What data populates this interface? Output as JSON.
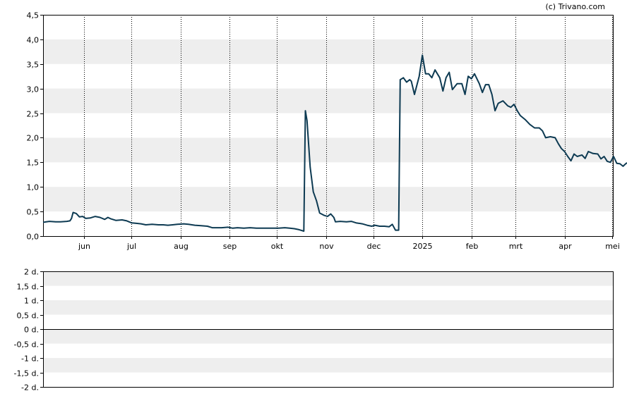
{
  "copyright": "(c) Trivano.com",
  "colors": {
    "line": "#0d3a52",
    "band": "#eeeeee",
    "frame": "#000000",
    "grid": "#000000"
  },
  "chart_data": [
    {
      "type": "line",
      "title": "",
      "xlabel": "",
      "ylabel": "",
      "ylim": [
        0,
        4.5
      ],
      "y_ticks": [
        "0,0",
        "0,5",
        "1,0",
        "1,5",
        "2,0",
        "2,5",
        "3,0",
        "3,5",
        "4,0",
        "4,5"
      ],
      "x_ticks": [
        "jun",
        "jul",
        "aug",
        "sep",
        "okt",
        "nov",
        "dec",
        "2025",
        "feb",
        "mrt",
        "apr",
        "mei"
      ],
      "x_range": [
        "2024-05-06",
        "2025-05-02"
      ],
      "x_tick_dates": [
        "2024-06-01",
        "2024-07-01",
        "2024-08-01",
        "2024-09-01",
        "2024-10-01",
        "2024-11-01",
        "2024-12-01",
        "2025-01-01",
        "2025-02-01",
        "2025-03-01",
        "2025-04-01",
        "2025-05-01"
      ],
      "vertical_grid": "dotted",
      "horizontal_bands": true,
      "series": [
        {
          "points": [
            [
              "2024-05-06",
              0.28
            ],
            [
              "2024-05-08",
              0.29
            ],
            [
              "2024-05-10",
              0.3
            ],
            [
              "2024-05-14",
              0.29
            ],
            [
              "2024-05-17",
              0.29
            ],
            [
              "2024-05-21",
              0.3
            ],
            [
              "2024-05-23",
              0.31
            ],
            [
              "2024-05-24",
              0.36
            ],
            [
              "2024-05-25",
              0.48
            ],
            [
              "2024-05-27",
              0.46
            ],
            [
              "2024-05-29",
              0.39
            ],
            [
              "2024-05-31",
              0.4
            ],
            [
              "2024-06-02",
              0.36
            ],
            [
              "2024-06-05",
              0.37
            ],
            [
              "2024-06-08",
              0.4
            ],
            [
              "2024-06-11",
              0.38
            ],
            [
              "2024-06-14",
              0.34
            ],
            [
              "2024-06-16",
              0.38
            ],
            [
              "2024-06-18",
              0.35
            ],
            [
              "2024-06-21",
              0.32
            ],
            [
              "2024-06-25",
              0.33
            ],
            [
              "2024-06-28",
              0.31
            ],
            [
              "2024-07-01",
              0.27
            ],
            [
              "2024-07-04",
              0.26
            ],
            [
              "2024-07-07",
              0.25
            ],
            [
              "2024-07-10",
              0.23
            ],
            [
              "2024-07-14",
              0.24
            ],
            [
              "2024-07-18",
              0.23
            ],
            [
              "2024-07-21",
              0.23
            ],
            [
              "2024-07-24",
              0.22
            ],
            [
              "2024-07-27",
              0.23
            ],
            [
              "2024-07-30",
              0.24
            ],
            [
              "2024-08-03",
              0.25
            ],
            [
              "2024-08-06",
              0.24
            ],
            [
              "2024-08-10",
              0.22
            ],
            [
              "2024-08-14",
              0.21
            ],
            [
              "2024-08-18",
              0.2
            ],
            [
              "2024-08-21",
              0.17
            ],
            [
              "2024-08-24",
              0.17
            ],
            [
              "2024-08-27",
              0.17
            ],
            [
              "2024-08-31",
              0.18
            ],
            [
              "2024-09-03",
              0.16
            ],
            [
              "2024-09-06",
              0.17
            ],
            [
              "2024-09-10",
              0.16
            ],
            [
              "2024-09-14",
              0.17
            ],
            [
              "2024-09-18",
              0.16
            ],
            [
              "2024-09-21",
              0.16
            ],
            [
              "2024-09-25",
              0.16
            ],
            [
              "2024-09-29",
              0.16
            ],
            [
              "2024-10-02",
              0.16
            ],
            [
              "2024-10-06",
              0.17
            ],
            [
              "2024-10-09",
              0.16
            ],
            [
              "2024-10-12",
              0.15
            ],
            [
              "2024-10-15",
              0.13
            ],
            [
              "2024-10-18",
              0.1
            ],
            [
              "2024-10-19",
              2.55
            ],
            [
              "2024-10-20",
              2.35
            ],
            [
              "2024-10-22",
              1.4
            ],
            [
              "2024-10-24",
              0.9
            ],
            [
              "2024-10-26",
              0.72
            ],
            [
              "2024-10-28",
              0.47
            ],
            [
              "2024-10-31",
              0.42
            ],
            [
              "2024-11-02",
              0.4
            ],
            [
              "2024-11-04",
              0.45
            ],
            [
              "2024-11-06",
              0.38
            ],
            [
              "2024-11-07",
              0.29
            ],
            [
              "2024-11-10",
              0.3
            ],
            [
              "2024-11-14",
              0.29
            ],
            [
              "2024-11-17",
              0.3
            ],
            [
              "2024-11-20",
              0.27
            ],
            [
              "2024-11-24",
              0.25
            ],
            [
              "2024-11-27",
              0.22
            ],
            [
              "2024-11-30",
              0.2
            ],
            [
              "2024-12-02",
              0.22
            ],
            [
              "2024-12-05",
              0.2
            ],
            [
              "2024-12-08",
              0.2
            ],
            [
              "2024-12-11",
              0.19
            ],
            [
              "2024-12-13",
              0.24
            ],
            [
              "2024-12-15",
              0.12
            ],
            [
              "2024-12-17",
              0.12
            ],
            [
              "2024-12-18",
              3.18
            ],
            [
              "2024-12-20",
              3.22
            ],
            [
              "2024-12-22",
              3.13
            ],
            [
              "2024-12-24",
              3.18
            ],
            [
              "2024-12-25",
              3.15
            ],
            [
              "2024-12-27",
              2.88
            ],
            [
              "2024-12-30",
              3.25
            ],
            [
              "2025-01-01",
              3.68
            ],
            [
              "2025-01-03",
              3.3
            ],
            [
              "2025-01-05",
              3.3
            ],
            [
              "2025-01-07",
              3.22
            ],
            [
              "2025-01-09",
              3.38
            ],
            [
              "2025-01-12",
              3.22
            ],
            [
              "2025-01-14",
              2.95
            ],
            [
              "2025-01-16",
              3.22
            ],
            [
              "2025-01-18",
              3.33
            ],
            [
              "2025-01-20",
              2.98
            ],
            [
              "2025-01-23",
              3.1
            ],
            [
              "2025-01-26",
              3.1
            ],
            [
              "2025-01-28",
              2.88
            ],
            [
              "2025-01-30",
              3.25
            ],
            [
              "2025-02-01",
              3.2
            ],
            [
              "2025-02-03",
              3.3
            ],
            [
              "2025-02-06",
              3.1
            ],
            [
              "2025-02-08",
              2.92
            ],
            [
              "2025-02-10",
              3.08
            ],
            [
              "2025-02-12",
              3.08
            ],
            [
              "2025-02-14",
              2.88
            ],
            [
              "2025-02-16",
              2.55
            ],
            [
              "2025-02-18",
              2.7
            ],
            [
              "2025-02-21",
              2.75
            ],
            [
              "2025-02-24",
              2.65
            ],
            [
              "2025-02-26",
              2.62
            ],
            [
              "2025-02-28",
              2.68
            ],
            [
              "2025-03-02",
              2.55
            ],
            [
              "2025-03-04",
              2.45
            ],
            [
              "2025-03-07",
              2.37
            ],
            [
              "2025-03-10",
              2.27
            ],
            [
              "2025-03-13",
              2.2
            ],
            [
              "2025-03-16",
              2.2
            ],
            [
              "2025-03-18",
              2.14
            ],
            [
              "2025-03-20",
              2.0
            ],
            [
              "2025-03-23",
              2.02
            ],
            [
              "2025-03-26",
              2.0
            ],
            [
              "2025-03-28",
              1.88
            ],
            [
              "2025-03-30",
              1.78
            ],
            [
              "2025-04-01",
              1.72
            ],
            [
              "2025-04-03",
              1.62
            ],
            [
              "2025-04-05",
              1.53
            ],
            [
              "2025-04-07",
              1.67
            ],
            [
              "2025-04-09",
              1.62
            ],
            [
              "2025-04-12",
              1.65
            ],
            [
              "2025-04-14",
              1.58
            ],
            [
              "2025-04-16",
              1.72
            ],
            [
              "2025-04-19",
              1.68
            ],
            [
              "2025-04-22",
              1.67
            ],
            [
              "2025-04-24",
              1.57
            ],
            [
              "2025-04-26",
              1.62
            ],
            [
              "2025-04-28",
              1.52
            ],
            [
              "2025-04-30",
              1.5
            ],
            [
              "2025-05-02",
              1.62
            ],
            [
              "2025-05-04",
              1.48
            ],
            [
              "2025-05-06",
              1.47
            ],
            [
              "2025-05-08",
              1.42
            ],
            [
              "2025-05-10",
              1.48
            ],
            [
              "2025-05-12",
              1.5
            ],
            [
              "2025-05-14",
              1.32
            ],
            [
              "2025-05-16",
              1.25
            ],
            [
              "2025-05-18",
              1.32
            ],
            [
              "2025-05-20",
              1.22
            ],
            [
              "2025-05-22",
              1.32
            ],
            [
              "2025-05-25",
              1.28
            ],
            [
              "2025-05-28",
              1.24
            ],
            [
              "2025-05-31",
              1.26
            ]
          ]
        }
      ]
    },
    {
      "type": "line",
      "title": "",
      "y_ticks": [
        "2 d.",
        "1,5 d.",
        "1 d.",
        "0,5 d.",
        "0 d.",
        "-0,5 d.",
        "-1 d.",
        "-1,5 d.",
        "-2 d."
      ],
      "ylim": [
        -2,
        2
      ],
      "horizontal_bands": true,
      "zero_line": true,
      "series": []
    }
  ]
}
